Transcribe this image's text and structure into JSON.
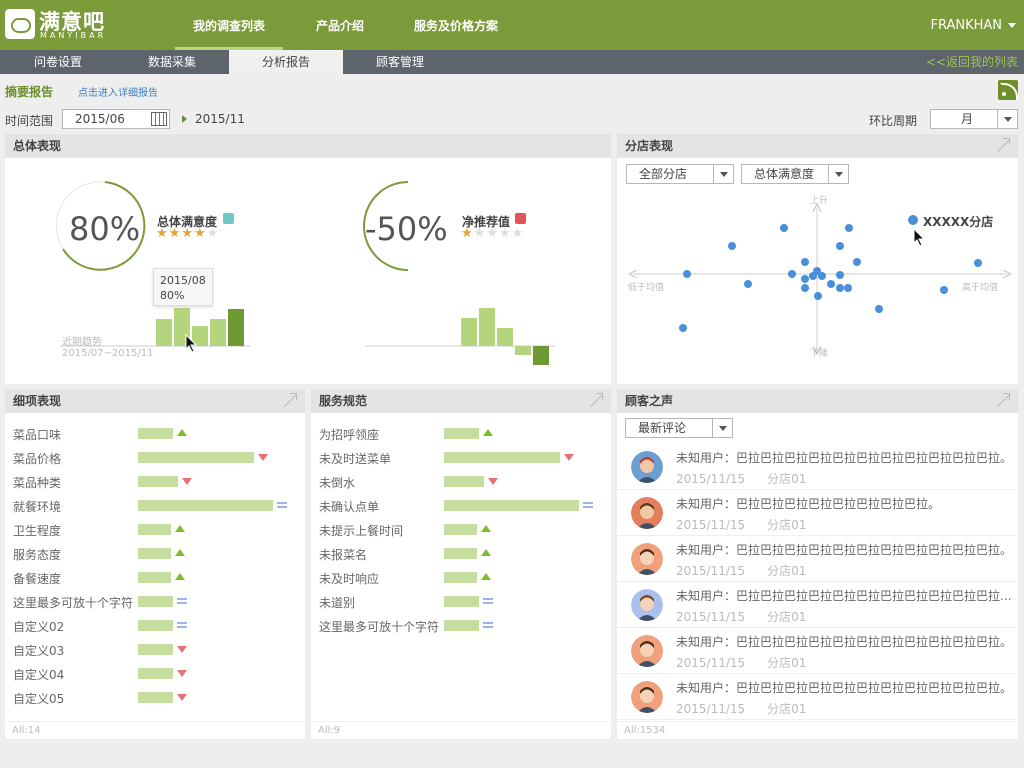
{
  "app": {
    "logo_cn": "满意吧",
    "logo_en": "MANYIBAR",
    "nav": [
      "我的调查列表",
      "产品介绍",
      "服务及价格方案"
    ],
    "user": "FRANKHAN"
  },
  "subnav": {
    "tabs": [
      "问卷设置",
      "数据采集",
      "分析报告",
      "顾客管理"
    ],
    "back": "<<返回我的列表"
  },
  "summary": {
    "title": "摘要报告",
    "detail_link": "点击进入详细报告"
  },
  "filters": {
    "range_label": "时间范围",
    "start": "2015/06",
    "end": "2015/11",
    "period_label": "环比周期",
    "period": "月"
  },
  "overall": {
    "title": "总体表现",
    "kpi1": {
      "value": "80%",
      "name": "总体满意度",
      "stars": 4,
      "color": "#6dcbc4"
    },
    "kpi2": {
      "value": "-50%",
      "name": "净推荐值",
      "stars": 1,
      "color": "#e05555"
    },
    "tooltip": {
      "date": "2015/08",
      "value": "80%"
    },
    "trend_label": "近期趋势",
    "trend_range": "2015/07~2015/11"
  },
  "branch": {
    "title": "分店表现",
    "select1": "全部分店",
    "select2": "总体满意度",
    "axis_up": "上升",
    "axis_down": "下降",
    "axis_left": "低于均值",
    "axis_right": "高于均值",
    "highlight": "XXXXX分店"
  },
  "details": {
    "title": "细项表现",
    "footer": "All:14",
    "rows": [
      {
        "label": "菜品口味",
        "trend": "up"
      },
      {
        "label": "菜品价格",
        "trend": "down"
      },
      {
        "label": "菜品种类",
        "trend": "down"
      },
      {
        "label": "就餐环境",
        "trend": "eq"
      },
      {
        "label": "卫生程度",
        "trend": "up"
      },
      {
        "label": "服务态度",
        "trend": "up"
      },
      {
        "label": "备餐速度",
        "trend": "up"
      },
      {
        "label": "这里最多可放十个字符",
        "trend": "eq"
      },
      {
        "label": "自定义02",
        "trend": "eq"
      },
      {
        "label": "自定义03",
        "trend": "down"
      },
      {
        "label": "自定义04",
        "trend": "down"
      },
      {
        "label": "自定义05",
        "trend": "down"
      }
    ]
  },
  "service": {
    "title": "服务规范",
    "footer": "All:9",
    "rows": [
      {
        "label": "为招呼领座",
        "trend": "up"
      },
      {
        "label": "未及时送菜单",
        "trend": "down"
      },
      {
        "label": "未倒水",
        "trend": "down"
      },
      {
        "label": "未确认点单",
        "trend": "eq"
      },
      {
        "label": "未提示上餐时间",
        "trend": "up"
      },
      {
        "label": "未报菜名",
        "trend": "up"
      },
      {
        "label": "未及时响应",
        "trend": "up"
      },
      {
        "label": "未道别",
        "trend": "eq"
      },
      {
        "label": "这里最多可放十个字符",
        "trend": "eq"
      }
    ]
  },
  "voice": {
    "title": "顾客之声",
    "select": "最新评论",
    "footer": "All:1534",
    "items": [
      {
        "text": "未知用户：巴拉巴拉巴拉巴拉巴拉巴拉巴拉巴拉巴拉巴拉巴拉。",
        "date": "2015/11/15",
        "store": "分店01"
      },
      {
        "text": "未知用户：巴拉巴拉巴拉巴拉巴拉巴拉巴拉巴拉。",
        "date": "2015/11/15",
        "store": "分店01"
      },
      {
        "text": "未知用户：巴拉巴拉巴拉巴拉巴拉巴拉巴拉巴拉巴拉巴拉巴拉。",
        "date": "2015/11/15",
        "store": "分店01"
      },
      {
        "text": "未知用户：巴拉巴拉巴拉巴拉巴拉巴拉巴拉巴拉巴拉巴拉巴拉...",
        "date": "2015/11/15",
        "store": "分店01"
      },
      {
        "text": "未知用户：巴拉巴拉巴拉巴拉巴拉巴拉巴拉巴拉巴拉巴拉巴拉。",
        "date": "2015/11/15",
        "store": "分店01"
      },
      {
        "text": "未知用户：巴拉巴拉巴拉巴拉巴拉巴拉巴拉巴拉巴拉巴拉巴拉。",
        "date": "2015/11/15",
        "store": "分店01"
      }
    ]
  }
}
